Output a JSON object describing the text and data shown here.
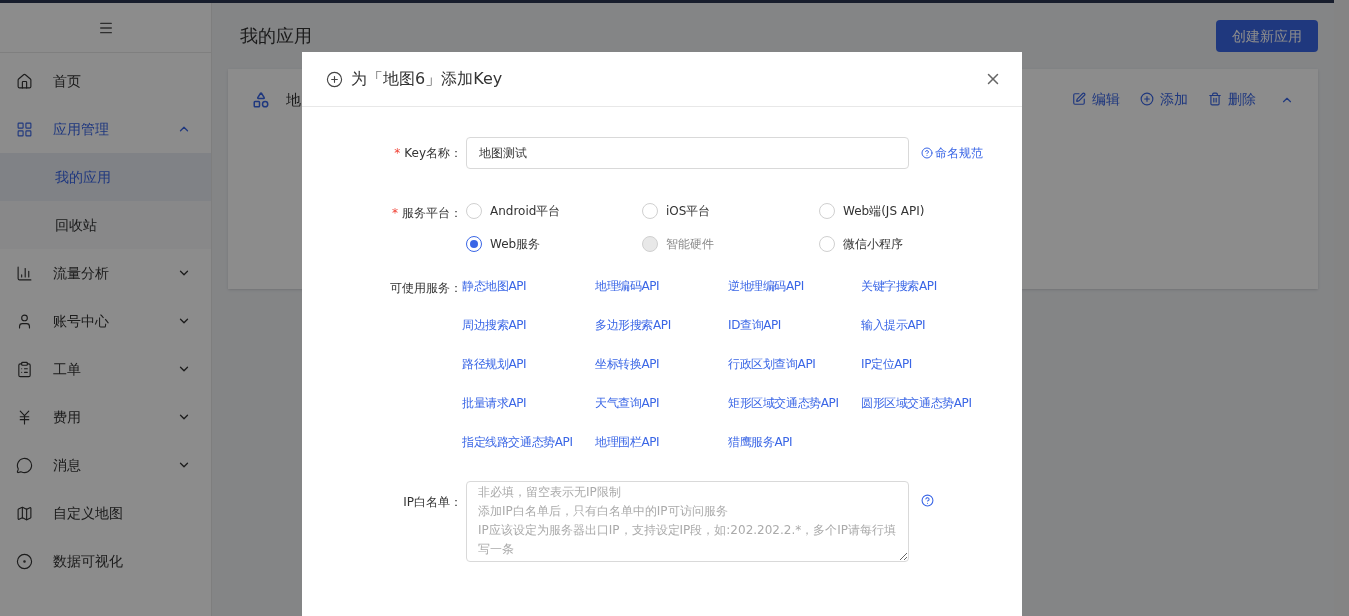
{
  "sidebar": {
    "items": [
      {
        "label": "首页",
        "selected": false
      },
      {
        "label": "应用管理",
        "selected": true,
        "expanded": true,
        "children": [
          {
            "label": "我的应用",
            "selected": true
          },
          {
            "label": "回收站",
            "selected": false
          }
        ]
      },
      {
        "label": "流量分析",
        "selected": false,
        "expanded": false
      },
      {
        "label": "账号中心",
        "selected": false,
        "expanded": false
      },
      {
        "label": "工单",
        "selected": false,
        "expanded": false
      },
      {
        "label": "费用",
        "selected": false,
        "expanded": false
      },
      {
        "label": "消息",
        "selected": false,
        "expanded": false
      },
      {
        "label": "自定义地图",
        "selected": false
      },
      {
        "label": "数据可视化",
        "selected": false
      }
    ]
  },
  "page": {
    "title": "我的应用",
    "create_button": "创建新应用"
  },
  "app_card": {
    "name": "地",
    "actions": [
      "编辑",
      "添加",
      "删除"
    ]
  },
  "dialog": {
    "title": "为「地图6」添加Key",
    "key_name": {
      "label": "Key名称：",
      "required_mark": "*",
      "value": "地图测试",
      "help": "命名规范"
    },
    "platform": {
      "label": "服务平台：",
      "required_mark": "*",
      "options": [
        {
          "label": "Android平台",
          "selected": false,
          "disabled": false
        },
        {
          "label": "iOS平台",
          "selected": false,
          "disabled": false
        },
        {
          "label": "Web端(JS API)",
          "selected": false,
          "disabled": false
        },
        {
          "label": "Web服务",
          "selected": true,
          "disabled": false
        },
        {
          "label": "智能硬件",
          "selected": false,
          "disabled": true
        },
        {
          "label": "微信小程序",
          "selected": false,
          "disabled": false
        }
      ]
    },
    "services": {
      "label": "可使用服务：",
      "items": [
        "静态地图API",
        "地理编码API",
        "逆地理编码API",
        "关键字搜索API",
        "周边搜索API",
        "多边形搜索API",
        "ID查询API",
        "输入提示API",
        "路径规划API",
        "坐标转换API",
        "行政区划查询API",
        "IP定位API",
        "批量请求API",
        "天气查询API",
        "矩形区域交通态势API",
        "圆形区域交通态势API",
        "指定线路交通态势API",
        "地理围栏API",
        "猎鹰服务API"
      ]
    },
    "ip_whitelist": {
      "label": "IP白名单：",
      "placeholder_lines": [
        "非必填，留空表示无IP限制",
        "添加IP白名单后，只有白名单中的IP可访问服务",
        "IP应该设定为服务器出口IP，支持设定IP段，如:202.202.2.*，多个IP请每行填写一条"
      ]
    }
  }
}
